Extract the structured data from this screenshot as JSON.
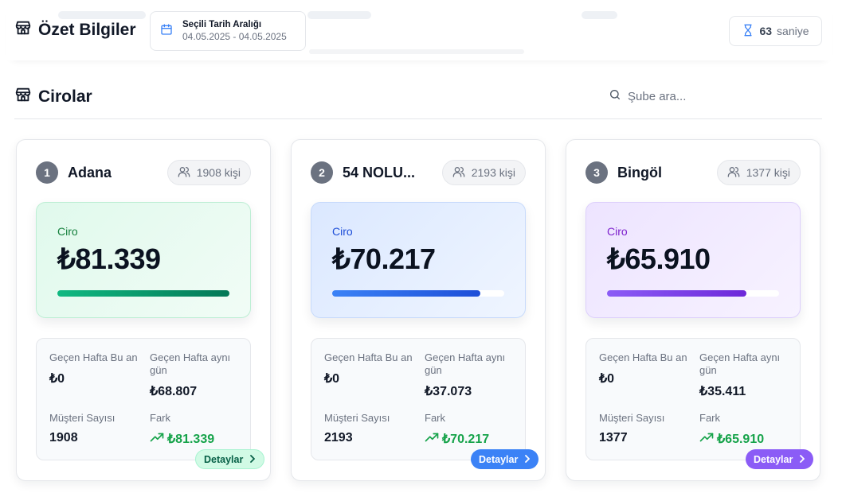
{
  "summary": {
    "title": "Özet Bilgiler",
    "date_range_label": "Seçili Tarih Aralığı",
    "date_range_value": "04.05.2025 - 04.05.2025",
    "timer_value": "63",
    "timer_unit": "saniye"
  },
  "section": {
    "title": "Cirolar",
    "search_placeholder": "Şube ara..."
  },
  "cards": [
    {
      "rank": "1",
      "name": "Adana",
      "people": "1908 kişi",
      "ciro_label": "Ciro",
      "ciro_value": "₺81.339",
      "progress": 1.0,
      "stats": {
        "last_week_now_label": "Geçen Hafta Bu an",
        "last_week_now_value": "₺0",
        "last_week_day_label": "Geçen Hafta aynı gün",
        "last_week_day_value": "₺68.807",
        "customers_label": "Müşteri Sayısı",
        "customers_value": "1908",
        "diff_label": "Fark",
        "diff_value": "₺81.339"
      },
      "details_label": "Detaylar",
      "accent": "#10b981"
    },
    {
      "rank": "2",
      "name": "54 NOLU...",
      "people": "2193 kişi",
      "ciro_label": "Ciro",
      "ciro_value": "₺70.217",
      "progress": 0.863,
      "stats": {
        "last_week_now_label": "Geçen Hafta Bu an",
        "last_week_now_value": "₺0",
        "last_week_day_label": "Geçen Hafta aynı gün",
        "last_week_day_value": "₺37.073",
        "customers_label": "Müşteri Sayısı",
        "customers_value": "2193",
        "diff_label": "Fark",
        "diff_value": "₺70.217"
      },
      "details_label": "Detaylar",
      "accent": "#3b82f6"
    },
    {
      "rank": "3",
      "name": "Bingöl",
      "people": "1377 kişi",
      "ciro_label": "Ciro",
      "ciro_value": "₺65.910",
      "progress": 0.81,
      "stats": {
        "last_week_now_label": "Geçen Hafta Bu an",
        "last_week_now_value": "₺0",
        "last_week_day_label": "Geçen Hafta aynı gün",
        "last_week_day_value": "₺35.411",
        "customers_label": "Müşteri Sayısı",
        "customers_value": "1377",
        "diff_label": "Fark",
        "diff_value": "₺65.910"
      },
      "details_label": "Detaylar",
      "accent": "#8b5cf6"
    }
  ]
}
